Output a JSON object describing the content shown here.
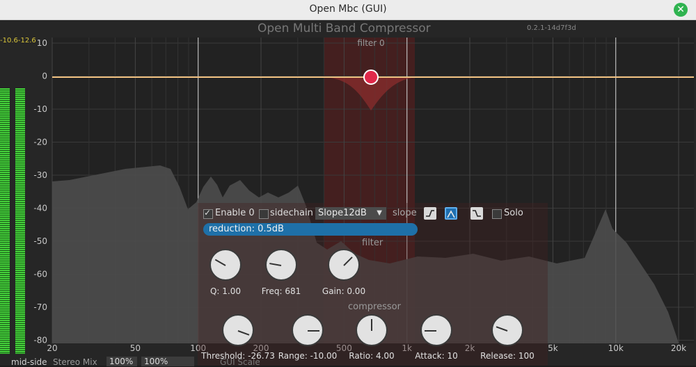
{
  "window": {
    "title": "Open Mbc (GUI)"
  },
  "app": {
    "title": "Open Multi Band Compressor",
    "version": "0.2.1-14d7f3d"
  },
  "meter": {
    "readout": "-10.6-12.6",
    "left_level": 0.78,
    "right_level": 0.78
  },
  "colors": {
    "accent": "#1e70a8",
    "node": "#e0284a",
    "meter": "#44d03a",
    "curve": "#f0c080",
    "band": "#6a2424"
  },
  "graph": {
    "filter_label": "filter 0",
    "y_ticks": [
      "10",
      "0",
      "-10",
      "-20",
      "-30",
      "-40",
      "-50",
      "-60",
      "-70",
      "-80"
    ],
    "x_ticks": [
      "20",
      "50",
      "100",
      "200",
      "500",
      "1k",
      "2k",
      "5k",
      "10k",
      "20k"
    ],
    "node": {
      "freq": 681,
      "gain_db": 0
    }
  },
  "panel": {
    "enable_label": "Enable 0",
    "enable_checked": true,
    "sidechain_label": "sidechain",
    "sidechain_checked": false,
    "slope_value": "Slope12dB",
    "slope_label": "slope",
    "filter_shapes": [
      "low-shelf-icon",
      "peak-icon",
      "high-shelf-icon"
    ],
    "active_shape": 1,
    "solo_label": "Solo",
    "solo_checked": false,
    "reduction": "reduction: 0.5dB",
    "filter_section": "filter",
    "compressor_section": "compressor",
    "filter_knobs": [
      {
        "label": "Q: 1.00"
      },
      {
        "label": "Freq: 681"
      },
      {
        "label": "Gain: 0.00"
      }
    ],
    "compressor_knobs": [
      {
        "label": "Threshold: -26.73"
      },
      {
        "label": "Range: -10.00"
      },
      {
        "label": "Ratio: 4.00"
      },
      {
        "label": "Attack: 10"
      },
      {
        "label": "Release: 100"
      }
    ]
  },
  "bottom": {
    "mid_side": "mid-side",
    "stereo_mix": "Stereo Mix",
    "stereo_mix_value": "100%",
    "gui_scale_value": "100%",
    "gui_scale": "GUI Scale"
  }
}
